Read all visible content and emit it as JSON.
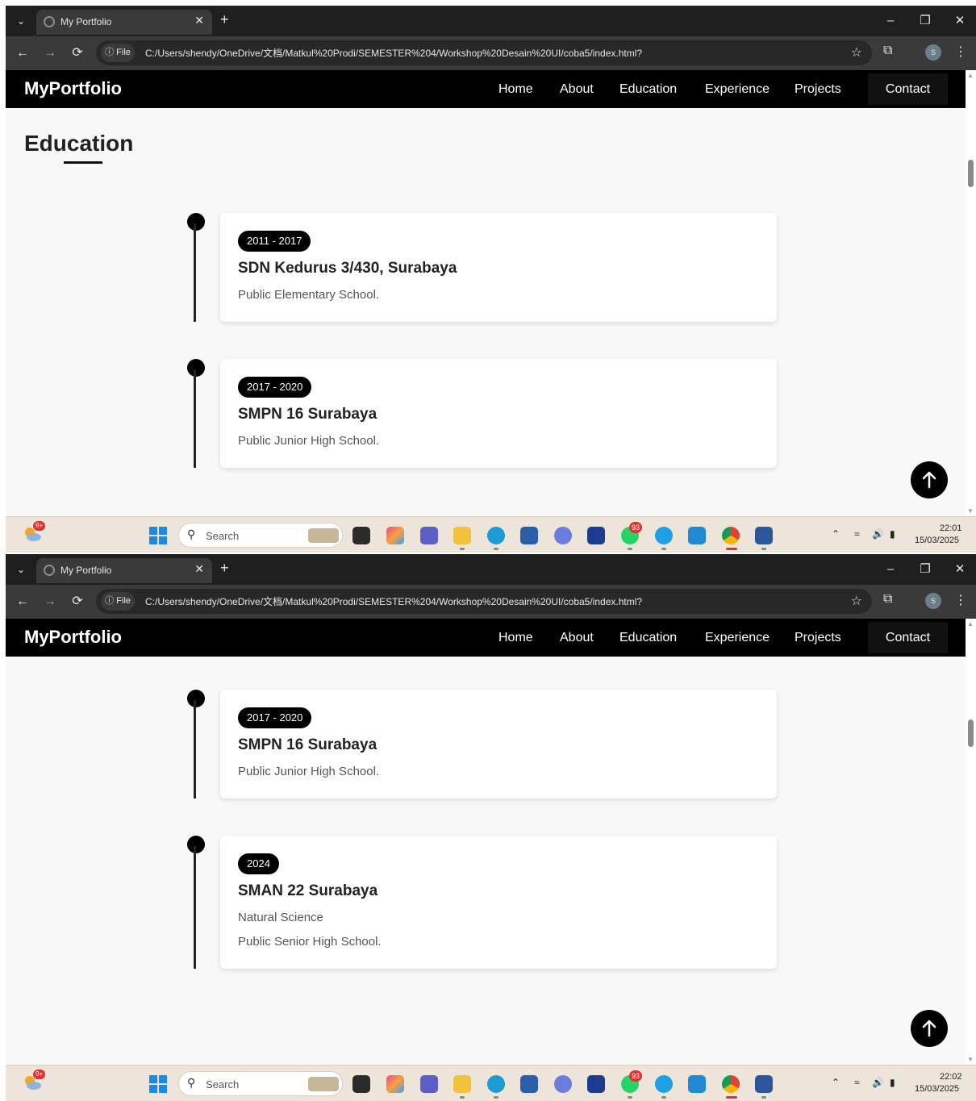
{
  "browser": {
    "tab_title": "My Portfolio",
    "url": "C:/Users/shendy/OneDrive/文档/Matkul%20Prodi/SEMESTER%204/Workshop%20Desain%20UI/coba5/index.html?",
    "file_label": "File",
    "profile_initial": "S"
  },
  "site": {
    "brand": "MyPortfolio",
    "nav": {
      "home": "Home",
      "about": "About",
      "education": "Education",
      "experience": "Experience",
      "projects": "Projects",
      "contact": "Contact"
    },
    "section_title": "Education"
  },
  "shot1": {
    "entries": [
      {
        "years": "2011 - 2017",
        "school": "SDN Kedurus 3/430, Surabaya",
        "lines": [
          "Public Elementary School."
        ]
      },
      {
        "years": "2017 - 2020",
        "school": "SMPN 16 Surabaya",
        "lines": [
          "Public Junior High School."
        ]
      }
    ]
  },
  "shot2": {
    "entries": [
      {
        "years": "2017 - 2020",
        "school": "SMPN 16 Surabaya",
        "lines": [
          "Public Junior High School."
        ]
      },
      {
        "years": "2024",
        "school": "SMAN 22 Surabaya",
        "lines": [
          "Natural Science",
          "Public Senior High School."
        ]
      }
    ]
  },
  "taskbar": {
    "search_label": "Search",
    "weather_badge": "9+",
    "whatsapp_badge": "93",
    "shot1_time": "22:01",
    "shot2_time": "22:02",
    "date": "15/03/2025"
  },
  "colors": {
    "nav_bg": "#000000",
    "page_bg": "#f8f8f8",
    "accent": "#000000",
    "taskbar_bg": "#ede5da"
  }
}
